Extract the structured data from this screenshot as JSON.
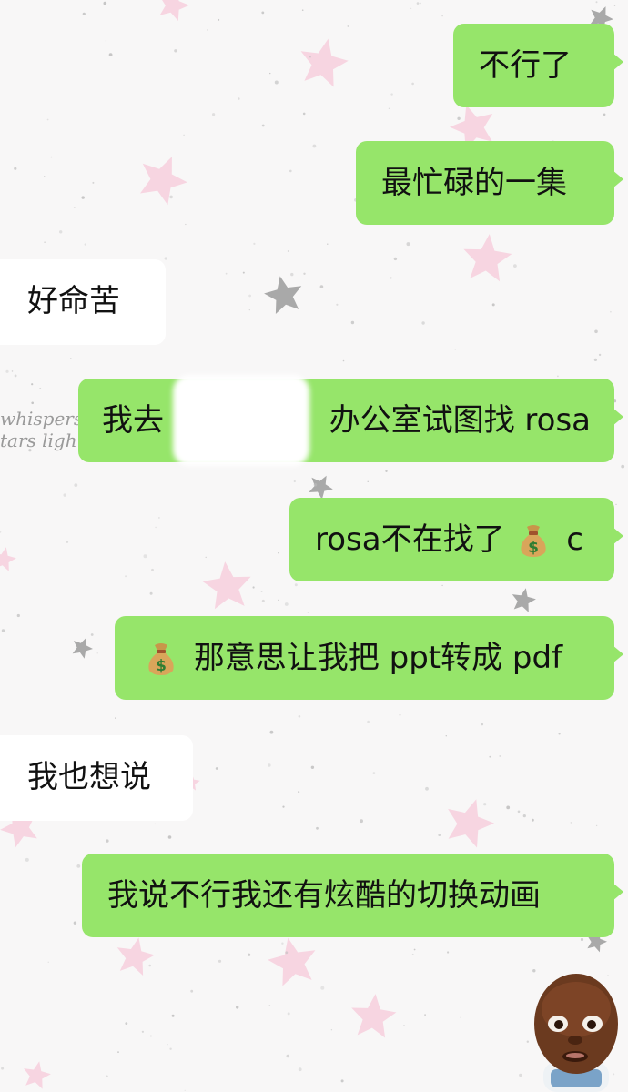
{
  "background": {
    "pattern": "pink-and-gray-stars",
    "base_color": "#f8f7f7",
    "star_colors": [
      "#f7d3df",
      "#8f8f8f"
    ],
    "faded_text_lines": [
      "whispers",
      "tars ligh"
    ]
  },
  "colors": {
    "outgoing_bubble": "#96e56a",
    "incoming_bubble": "#ffffff",
    "text": "#111111"
  },
  "messages": [
    {
      "id": "m1",
      "sender": "me",
      "text": "不行了"
    },
    {
      "id": "m2",
      "sender": "me",
      "text": "最忙碌的一集"
    },
    {
      "id": "m3",
      "sender": "them",
      "text": "好命苦"
    },
    {
      "id": "m4",
      "sender": "me",
      "text_before_redaction": "我去",
      "text_after_redaction": "办公室试图找 rosa",
      "redacted": true
    },
    {
      "id": "m5",
      "sender": "me",
      "text_before_emoji": "rosa不在找了",
      "emoji": "money-bag",
      "text_after_emoji": "c"
    },
    {
      "id": "m6",
      "sender": "me",
      "emoji": "money-bag",
      "text_after_emoji": "那意思让我把 ppt转成 pdf"
    },
    {
      "id": "m7",
      "sender": "them",
      "text": "我也想说"
    },
    {
      "id": "m8",
      "sender": "me",
      "text": "我说不行我还有炫酷的切换动画"
    }
  ],
  "sticker": {
    "name": "bald-face-sticker",
    "description_icon": "face-sticker"
  }
}
